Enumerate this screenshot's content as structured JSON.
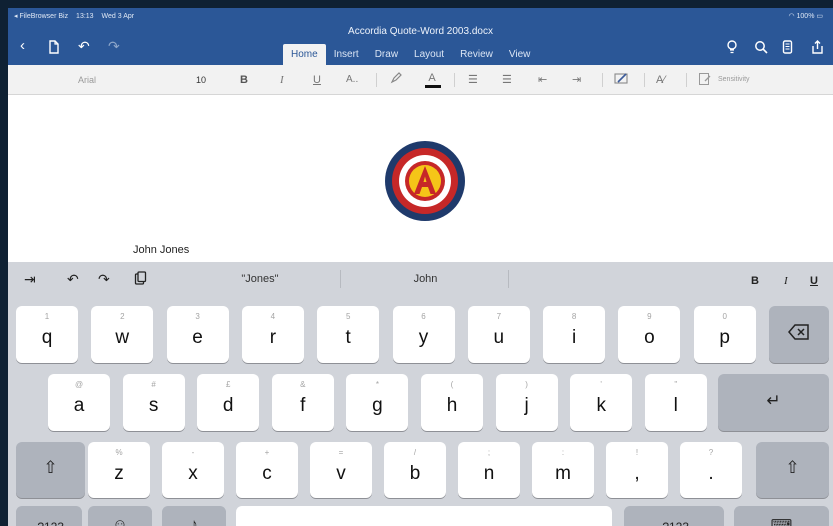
{
  "status_bar": {
    "back_app": "◂ FileBrowser Biz",
    "time": "13:13",
    "date": "Wed 3 Apr",
    "battery": "100%"
  },
  "titlebar": {
    "doc_title": "Accordia Quote-Word 2003.docx"
  },
  "tabs": [
    "Home",
    "Insert",
    "Draw",
    "Layout",
    "Review",
    "View"
  ],
  "format_bar": {
    "font_name": "Arial",
    "font_size": "10",
    "bold": "B",
    "italic": "I",
    "underline": "U",
    "font_style": "A..",
    "font_color": "A",
    "sensitivity": "Sensitivity"
  },
  "document": {
    "text": "John Jones",
    "logo_letter": "A"
  },
  "quicktype": {
    "suggestions": [
      "\"Jones\"",
      "John",
      ""
    ],
    "bold": "B",
    "italic": "I",
    "underline": "U"
  },
  "keyboard": {
    "row1": [
      {
        "hint": "1",
        "main": "q"
      },
      {
        "hint": "2",
        "main": "w"
      },
      {
        "hint": "3",
        "main": "e"
      },
      {
        "hint": "4",
        "main": "r"
      },
      {
        "hint": "5",
        "main": "t"
      },
      {
        "hint": "6",
        "main": "y"
      },
      {
        "hint": "7",
        "main": "u"
      },
      {
        "hint": "8",
        "main": "i"
      },
      {
        "hint": "9",
        "main": "o"
      },
      {
        "hint": "0",
        "main": "p"
      }
    ],
    "row2": [
      {
        "hint": "@",
        "main": "a"
      },
      {
        "hint": "#",
        "main": "s"
      },
      {
        "hint": "£",
        "main": "d"
      },
      {
        "hint": "&",
        "main": "f"
      },
      {
        "hint": "*",
        "main": "g"
      },
      {
        "hint": "(",
        "main": "h"
      },
      {
        "hint": ")",
        "main": "j"
      },
      {
        "hint": "'",
        "main": "k"
      },
      {
        "hint": "\"",
        "main": "l"
      }
    ],
    "row3": [
      {
        "hint": "%",
        "main": "z"
      },
      {
        "hint": "-",
        "main": "x"
      },
      {
        "hint": "+",
        "main": "c"
      },
      {
        "hint": "=",
        "main": "v"
      },
      {
        "hint": "/",
        "main": "b"
      },
      {
        "hint": ";",
        "main": "n"
      },
      {
        "hint": ":",
        "main": "m"
      },
      {
        "hint": "!",
        "main": ","
      },
      {
        "hint": "?",
        "main": "."
      }
    ],
    "num_key": ".?123"
  },
  "icons": {
    "back": "back-chevron-icon",
    "new_doc": "document-icon",
    "undo": "undo-icon",
    "redo": "redo-icon",
    "ideas": "lightbulb-icon",
    "search": "search-icon",
    "phone_view": "phone-view-icon",
    "share": "share-icon",
    "backspace": "backspace-icon",
    "return": "return-icon",
    "shift": "shift-icon",
    "emoji": "emoji-icon",
    "dictation": "microphone-icon",
    "hide_keyboard": "keyboard-hide-icon",
    "tab": "tab-icon",
    "kb_undo": "undo-icon",
    "kb_redo": "redo-icon",
    "paste": "paste-icon"
  },
  "colors": {
    "word_blue": "#2b5797",
    "logo_red": "#c62828",
    "logo_navy": "#1f3a6b",
    "logo_yellow": "#f5c518"
  }
}
